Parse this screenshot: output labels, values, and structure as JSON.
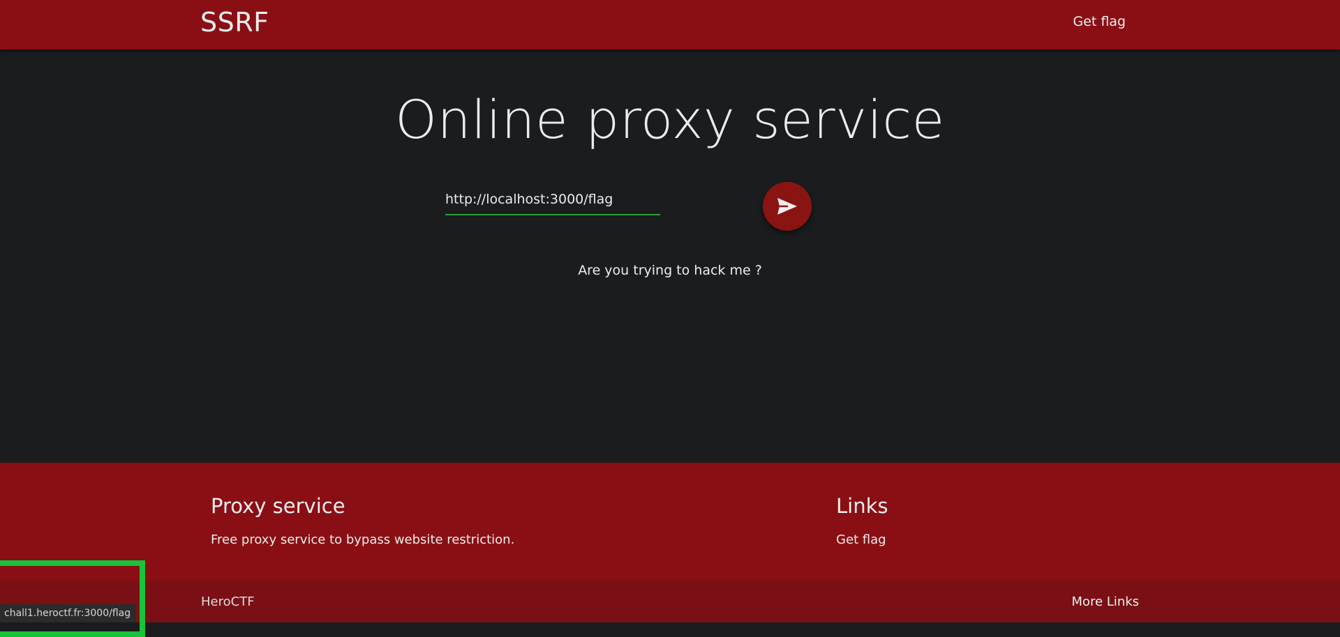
{
  "navbar": {
    "brand": "SSRF",
    "get_flag": "Get flag"
  },
  "main": {
    "title": "Online proxy service",
    "url_input_value": "http://localhost:3000/flag",
    "send_icon": "send-icon",
    "result_message": "Are you trying to hack me ?"
  },
  "footer": {
    "about_title": "Proxy service",
    "about_text": "Free proxy service to bypass website restriction.",
    "links_title": "Links",
    "links": [
      "Get flag"
    ],
    "copyright": "HeroCTF",
    "more_links": "More Links"
  },
  "status_bar": {
    "url": "chall1.heroctf.fr:3000/flag"
  },
  "colors": {
    "primary": "#8a0f14",
    "background": "#1b1c1e",
    "input_underline": "#26a33c",
    "highlight": "#17c43a"
  }
}
